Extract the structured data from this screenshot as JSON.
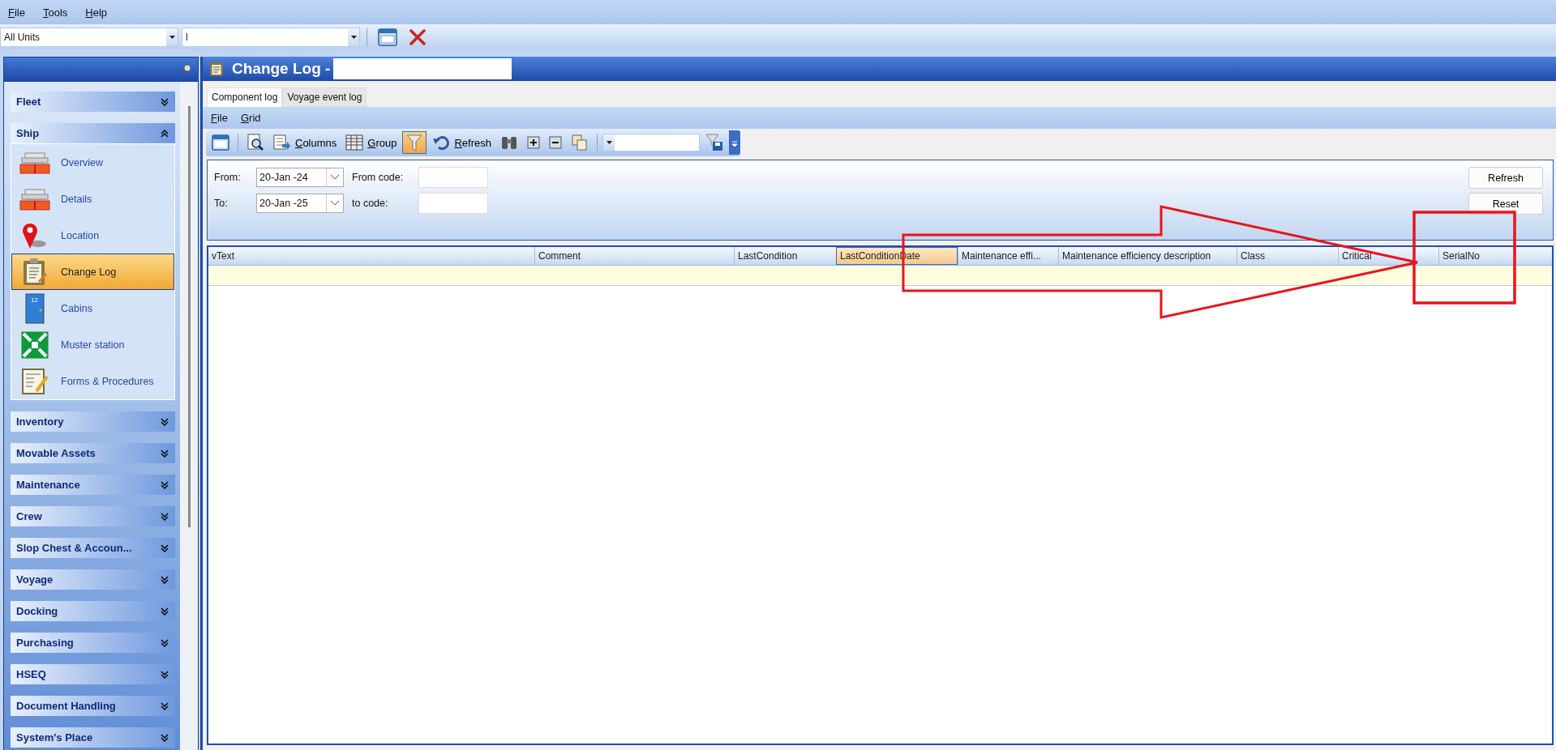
{
  "menu_bar": [
    {
      "label": "File"
    },
    {
      "label": "Tools"
    },
    {
      "label": "Help"
    }
  ],
  "top_toolbar": {
    "unit_selector": {
      "value": "All Units"
    },
    "second_selector": {
      "value": "l"
    },
    "buttons": [
      {
        "kind": "window"
      },
      {
        "kind": "close"
      }
    ]
  },
  "sidebar": {
    "groups": [
      {
        "label": "Fleet",
        "expanded": false
      },
      {
        "label": "Ship",
        "expanded": true,
        "items": [
          {
            "label": "Overview",
            "kind": "ship",
            "selected": false
          },
          {
            "label": "Details",
            "kind": "ship",
            "selected": false
          },
          {
            "label": "Location",
            "kind": "pin",
            "selected": false
          },
          {
            "label": "Change Log",
            "kind": "clipboard",
            "selected": true
          },
          {
            "label": "Cabins",
            "kind": "door",
            "door_number": "12",
            "selected": false
          },
          {
            "label": "Muster station",
            "kind": "muster",
            "selected": false
          },
          {
            "label": "Forms & Procedures",
            "kind": "form",
            "selected": false
          }
        ]
      },
      {
        "label": "Inventory",
        "expanded": false
      },
      {
        "label": "Movable Assets",
        "expanded": false
      },
      {
        "label": "Maintenance",
        "expanded": false
      },
      {
        "label": "Crew",
        "expanded": false
      },
      {
        "label": "Slop Chest & Accoun...",
        "expanded": false
      },
      {
        "label": "Voyage",
        "expanded": false
      },
      {
        "label": "Docking",
        "expanded": false
      },
      {
        "label": "Purchasing",
        "expanded": false
      },
      {
        "label": "HSEQ",
        "expanded": false
      },
      {
        "label": "Document Handling",
        "expanded": false
      },
      {
        "label": "System's Place",
        "expanded": false
      }
    ]
  },
  "panel": {
    "title": "Change Log -",
    "tabs": [
      {
        "label": "Component log",
        "selected": true
      },
      {
        "label": "Voyage event log",
        "selected": false
      }
    ],
    "menu": [
      {
        "label": "File"
      },
      {
        "label": "Grid"
      }
    ],
    "toolbar": [
      {
        "kind": "window"
      },
      {
        "kind": "separator"
      },
      {
        "kind": "preview"
      },
      {
        "kind": "columns",
        "label": "Columns"
      },
      {
        "kind": "table",
        "label": "Group"
      },
      {
        "kind": "filter",
        "on": true
      },
      {
        "kind": "undo",
        "label": "Refresh"
      },
      {
        "kind": "binoculars"
      },
      {
        "kind": "plus"
      },
      {
        "kind": "minus"
      },
      {
        "kind": "copy"
      },
      {
        "kind": "separator"
      },
      {
        "kind": "combo"
      },
      {
        "kind": "filter-save"
      },
      {
        "kind": "overflow"
      }
    ],
    "filters": {
      "from": {
        "label": "From:",
        "value": "20-Jan -24"
      },
      "to": {
        "label": "To:",
        "value": "20-Jan -25"
      },
      "from_code": {
        "label": "From code:"
      },
      "to_code": {
        "label": "to code:"
      },
      "buttons": [
        {
          "label": "Refresh"
        },
        {
          "label": "Reset"
        }
      ]
    },
    "grid": {
      "columns": [
        {
          "label": "vText",
          "selected": false
        },
        {
          "label": "Comment",
          "selected": false
        },
        {
          "label": "LastCondition",
          "selected": false
        },
        {
          "label": "LastConditionDate",
          "selected": true
        },
        {
          "label": "Maintenance effi...",
          "selected": false
        },
        {
          "label": "Maintenance efficiency description",
          "selected": false
        },
        {
          "label": "Class",
          "selected": false
        },
        {
          "label": "Critical",
          "selected": false
        },
        {
          "label": "SerialNo",
          "selected": false
        }
      ]
    }
  },
  "annotations": [
    {
      "kind": "arrow"
    },
    {
      "kind": "box"
    }
  ]
}
